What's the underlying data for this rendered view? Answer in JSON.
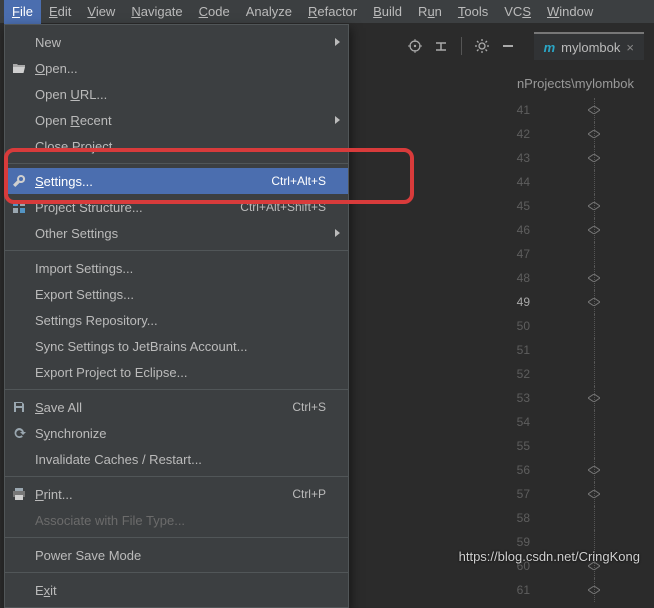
{
  "menubar": {
    "items": [
      {
        "label": "File",
        "u": "F"
      },
      {
        "label": "Edit",
        "u": "E"
      },
      {
        "label": "View",
        "u": "V"
      },
      {
        "label": "Navigate",
        "u": "N"
      },
      {
        "label": "Code",
        "u": "C"
      },
      {
        "label": "Analyze",
        "u": ""
      },
      {
        "label": "Refactor",
        "u": "R"
      },
      {
        "label": "Build",
        "u": "B"
      },
      {
        "label": "Run",
        "u": "u"
      },
      {
        "label": "Tools",
        "u": "T"
      },
      {
        "label": "VCS",
        "u": "S"
      },
      {
        "label": "Window",
        "u": "W"
      }
    ]
  },
  "tab": {
    "label": "mylombok"
  },
  "breadcrumb": "nProjects\\mylombok",
  "gutter": {
    "start": 41,
    "end": 61,
    "active": 49
  },
  "file_menu": {
    "items": [
      {
        "label": "New",
        "submenu": true
      },
      {
        "label": "Open...",
        "u": "O",
        "icon": "folder-open-icon"
      },
      {
        "label": "Open URL...",
        "u": "U"
      },
      {
        "label": "Open Recent",
        "u": "R",
        "submenu": true
      },
      {
        "label": "Close Project"
      },
      {
        "sep": true
      },
      {
        "label": "Settings...",
        "u": "S",
        "shortcut": "Ctrl+Alt+S",
        "icon": "wrench-icon",
        "highlight": true
      },
      {
        "label": "Project Structure...",
        "shortcut": "Ctrl+Alt+Shift+S",
        "icon": "project-structure-icon"
      },
      {
        "label": "Other Settings",
        "submenu": true
      },
      {
        "sep": true
      },
      {
        "label": "Import Settings..."
      },
      {
        "label": "Export Settings..."
      },
      {
        "label": "Settings Repository..."
      },
      {
        "label": "Sync Settings to JetBrains Account..."
      },
      {
        "label": "Export Project to Eclipse..."
      },
      {
        "sep": true
      },
      {
        "label": "Save All",
        "u": "S",
        "shortcut": "Ctrl+S",
        "icon": "save-icon"
      },
      {
        "label": "Synchronize",
        "u": "y",
        "icon": "sync-icon"
      },
      {
        "label": "Invalidate Caches / Restart..."
      },
      {
        "sep": true
      },
      {
        "label": "Print...",
        "u": "P",
        "shortcut": "Ctrl+P",
        "icon": "print-icon"
      },
      {
        "label": "Associate with File Type...",
        "disabled": true
      },
      {
        "sep": true
      },
      {
        "label": "Power Save Mode"
      },
      {
        "sep": true
      },
      {
        "label": "Exit",
        "u": "x"
      }
    ]
  },
  "watermark": "https://blog.csdn.net/CringKong"
}
